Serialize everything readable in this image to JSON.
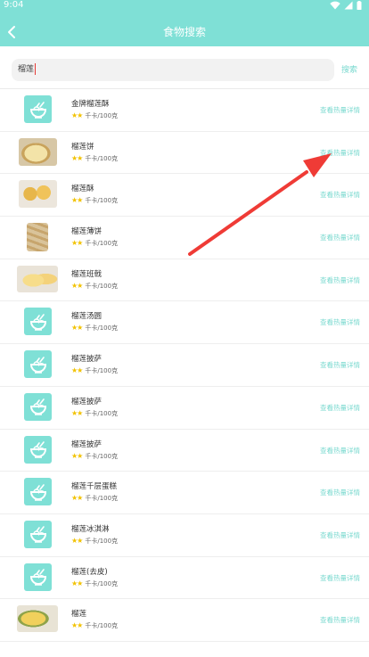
{
  "status_bar": {
    "time": "9:04"
  },
  "header": {
    "title": "食物搜索"
  },
  "search": {
    "value": "榴莲",
    "button_label": "搜索"
  },
  "colors": {
    "accent": "#7fe0d6",
    "star": "#f2c200",
    "arrow": "#ef3b36"
  },
  "results": [
    {
      "name": "金牌榴莲酥",
      "stars": "★★",
      "calories": "千卡/100克",
      "detail": "查看热量详情",
      "image": "placeholder"
    },
    {
      "name": "榴莲饼",
      "stars": "★★",
      "calories": "千卡/100克",
      "detail": "查看热量详情",
      "image": "photo"
    },
    {
      "name": "榴莲酥",
      "stars": "★★",
      "calories": "千卡/100克",
      "detail": "查看热量详情",
      "image": "photo"
    },
    {
      "name": "榴莲薄饼",
      "stars": "★★",
      "calories": "千卡/100克",
      "detail": "查看热量详情",
      "image": "photo"
    },
    {
      "name": "榴莲班戟",
      "stars": "★★",
      "calories": "千卡/100克",
      "detail": "查看热量详情",
      "image": "photo"
    },
    {
      "name": "榴莲汤圆",
      "stars": "★★",
      "calories": "千卡/100克",
      "detail": "查看热量详情",
      "image": "placeholder"
    },
    {
      "name": "榴莲披萨",
      "stars": "★★",
      "calories": "千卡/100克",
      "detail": "查看热量详情",
      "image": "placeholder"
    },
    {
      "name": "榴莲披萨",
      "stars": "★★",
      "calories": "千卡/100克",
      "detail": "查看热量详情",
      "image": "placeholder"
    },
    {
      "name": "榴莲披萨",
      "stars": "★★",
      "calories": "千卡/100克",
      "detail": "查看热量详情",
      "image": "placeholder"
    },
    {
      "name": "榴莲千层蛋糕",
      "stars": "★★",
      "calories": "千卡/100克",
      "detail": "查看热量详情",
      "image": "placeholder"
    },
    {
      "name": "榴莲冰淇淋",
      "stars": "★★",
      "calories": "千卡/100克",
      "detail": "查看热量详情",
      "image": "placeholder"
    },
    {
      "name": "榴莲(去皮)",
      "stars": "★★",
      "calories": "千卡/100克",
      "detail": "查看热量详情",
      "image": "placeholder"
    },
    {
      "name": "榴莲",
      "stars": "★★",
      "calories": "千卡/100克",
      "detail": "查看热量详情",
      "image": "photo"
    }
  ]
}
